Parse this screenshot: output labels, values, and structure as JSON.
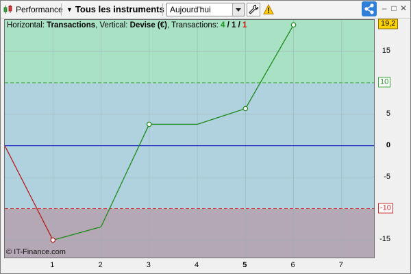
{
  "toolbar": {
    "performance_label": "Performance",
    "instruments_label": "Tous les instruments",
    "period_value": "Aujourd'hui"
  },
  "chart": {
    "legend": {
      "horizontal_label": "Horizontal:",
      "horizontal_value": "Transactions",
      "vertical_label": ", Vertical:",
      "vertical_value": "Devise (€)",
      "transactions_label": ", Transactions:",
      "count_total": "4",
      "count_win": "1",
      "count_loss": "1",
      "slash": " / "
    },
    "credit": "© IT-Finance.com",
    "last_value_label": "19,2",
    "upper_threshold_label": "10",
    "lower_threshold_label": "-10",
    "colors": {
      "upper_zone": "#a9e1c4",
      "middle_zone": "#b0d2de",
      "lower_zone": "#b4a8b4",
      "gain_line": "#1b8a1b",
      "loss_line": "#b51c1c",
      "zero_line": "#1a1ac8"
    }
  },
  "chart_data": {
    "type": "line",
    "x": [
      0,
      1,
      2,
      3,
      4,
      5,
      6
    ],
    "y": [
      0,
      -15,
      -12.9,
      3.4,
      3.4,
      5.9,
      19.2
    ],
    "markers_at_x": [
      1,
      3,
      5,
      6
    ],
    "xlim": [
      0,
      7.7
    ],
    "ylim": [
      -18,
      20
    ],
    "x_ticks": [
      "1",
      "2",
      "3",
      "4",
      "5",
      "6",
      "7"
    ],
    "y_ticks": [
      "15",
      "5",
      "0",
      "-5",
      "-15"
    ],
    "thresholds": [
      10,
      -10
    ],
    "grid": true
  }
}
